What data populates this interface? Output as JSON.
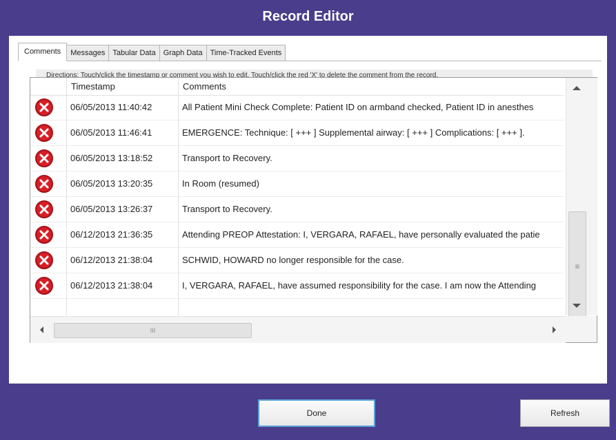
{
  "window": {
    "title": "Record Editor"
  },
  "tabs": [
    {
      "label": "Comments",
      "active": true
    },
    {
      "label": "Messages",
      "active": false
    },
    {
      "label": "Tabular Data",
      "active": false
    },
    {
      "label": "Graph Data",
      "active": false
    },
    {
      "label": "Time-Tracked Events",
      "active": false
    }
  ],
  "directions": "Directions: Touch/click the timestamp or comment you wish to edit. Touch/click the red 'X' to delete the comment from the record.",
  "table": {
    "columns": {
      "timestamp": "Timestamp",
      "comments": "Comments"
    },
    "rows": [
      {
        "timestamp": "06/05/2013 11:40:42",
        "comment": "All Patient Mini Check Complete:  Patient ID on armband checked, Patient ID in anesthes"
      },
      {
        "timestamp": "06/05/2013 11:46:41",
        "comment": "EMERGENCE: Technique: [ +++ ]  Supplemental airway: [ +++ ]  Complications: [ +++ ]."
      },
      {
        "timestamp": "06/05/2013 13:18:52",
        "comment": "Transport to Recovery."
      },
      {
        "timestamp": "06/05/2013 13:20:35",
        "comment": "In Room (resumed)"
      },
      {
        "timestamp": "06/05/2013 13:26:37",
        "comment": "Transport to Recovery."
      },
      {
        "timestamp": "06/12/2013 21:36:35",
        "comment": "Attending PREOP Attestation: I, VERGARA, RAFAEL, have personally evaluated the patie"
      },
      {
        "timestamp": "06/12/2013 21:38:04",
        "comment": "SCHWID, HOWARD no longer responsible for the case."
      },
      {
        "timestamp": "06/12/2013 21:38:04",
        "comment": "I, VERGARA, RAFAEL, have assumed responsibility for the case. I am now the Attending"
      }
    ]
  },
  "scrollbars": {
    "hscroll_thumb_glyph": "III",
    "vscroll_thumb_glyph": "≡"
  },
  "buttons": {
    "done": "Done",
    "refresh": "Refresh"
  },
  "colors": {
    "window_bg": "#4a3d8c",
    "delete_red": "#d81f26",
    "done_border": "#5aa3d8"
  },
  "icons": {
    "delete": "delete-x-icon"
  }
}
